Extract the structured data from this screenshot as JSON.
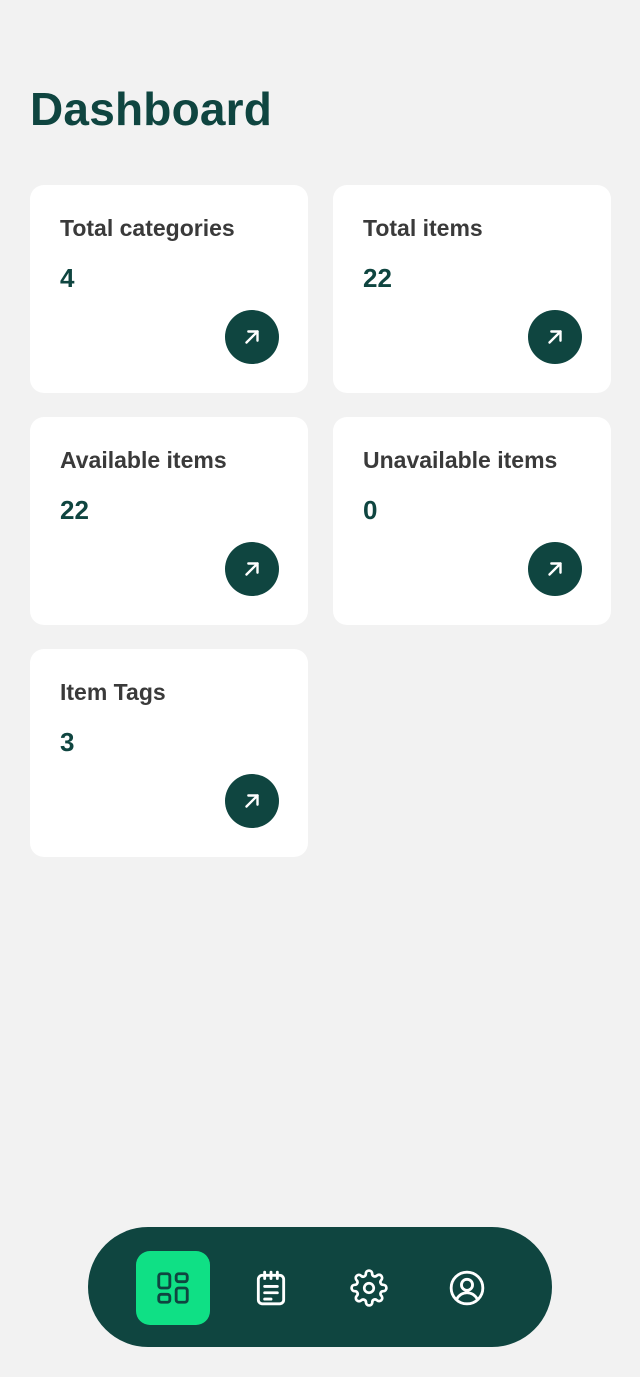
{
  "page": {
    "title": "Dashboard"
  },
  "cards": [
    {
      "label": "Total categories",
      "value": "4"
    },
    {
      "label": "Total items",
      "value": "22"
    },
    {
      "label": "Available items",
      "value": "22"
    },
    {
      "label": "Unavailable items",
      "value": "0"
    },
    {
      "label": "Item Tags",
      "value": "3"
    }
  ],
  "bottom_nav": {
    "items": [
      {
        "icon": "dashboard-icon",
        "active": true
      },
      {
        "icon": "notepad-icon",
        "active": false
      },
      {
        "icon": "gear-icon",
        "active": false
      },
      {
        "icon": "user-circle-icon",
        "active": false
      }
    ]
  },
  "colors": {
    "background": "#f2f2f2",
    "primary": "#0f4540",
    "accent": "#0fe085",
    "card": "#ffffff",
    "label_text": "#3a3a3a"
  }
}
